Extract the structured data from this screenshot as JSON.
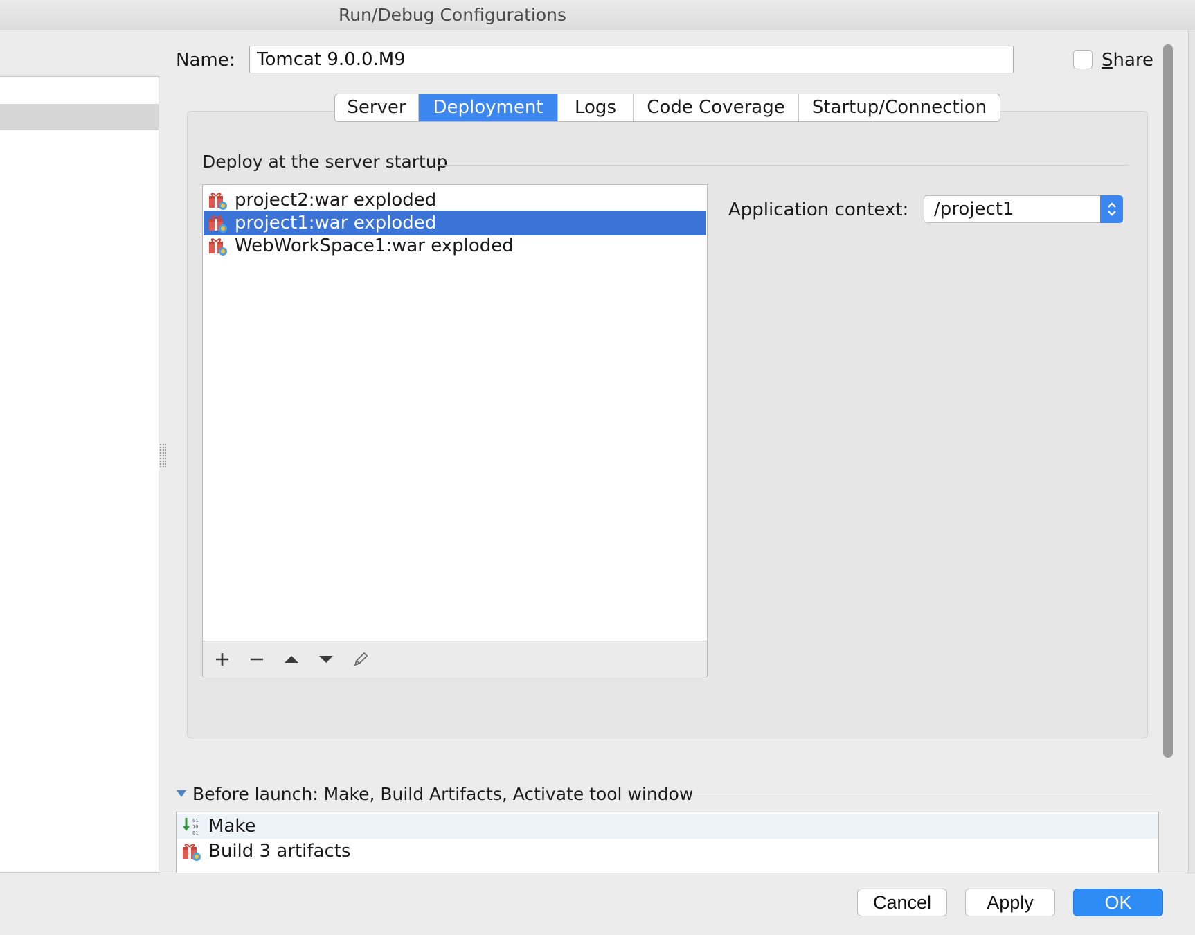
{
  "window": {
    "title": "Run/Debug Configurations"
  },
  "name_row": {
    "label": "Name:",
    "value": "Tomcat 9.0.0.M9",
    "share_label_first": "S",
    "share_label_rest": "hare",
    "share_checked": false
  },
  "tabs": [
    {
      "label": "Server",
      "active": false
    },
    {
      "label": "Deployment",
      "active": true
    },
    {
      "label": "Logs",
      "active": false
    },
    {
      "label": "Code Coverage",
      "active": false
    },
    {
      "label": "Startup/Connection",
      "active": false
    }
  ],
  "deployment": {
    "heading": "Deploy at the server startup",
    "artifacts": [
      {
        "label": "project2:war exploded",
        "selected": false
      },
      {
        "label": "project1:war exploded",
        "selected": true
      },
      {
        "label": "WebWorkSpace1:war exploded",
        "selected": false
      }
    ],
    "toolbar": [
      "add-icon",
      "remove-icon",
      "move-up-icon",
      "move-down-icon",
      "edit-pencil-icon"
    ],
    "context_label": "Application context:",
    "context_value": "/project1"
  },
  "before_launch": {
    "heading": "Before launch: Make, Build Artifacts, Activate tool window",
    "items": [
      {
        "label": "Make",
        "icon": "make-icon"
      },
      {
        "label": "Build 3 artifacts",
        "icon": "artifact-icon"
      }
    ]
  },
  "footer": {
    "cancel": "Cancel",
    "apply": "Apply",
    "ok": "OK"
  },
  "colors": {
    "accent": "#3b86ef",
    "selection": "#3b74d6",
    "ok_button": "#2d8cf5"
  }
}
